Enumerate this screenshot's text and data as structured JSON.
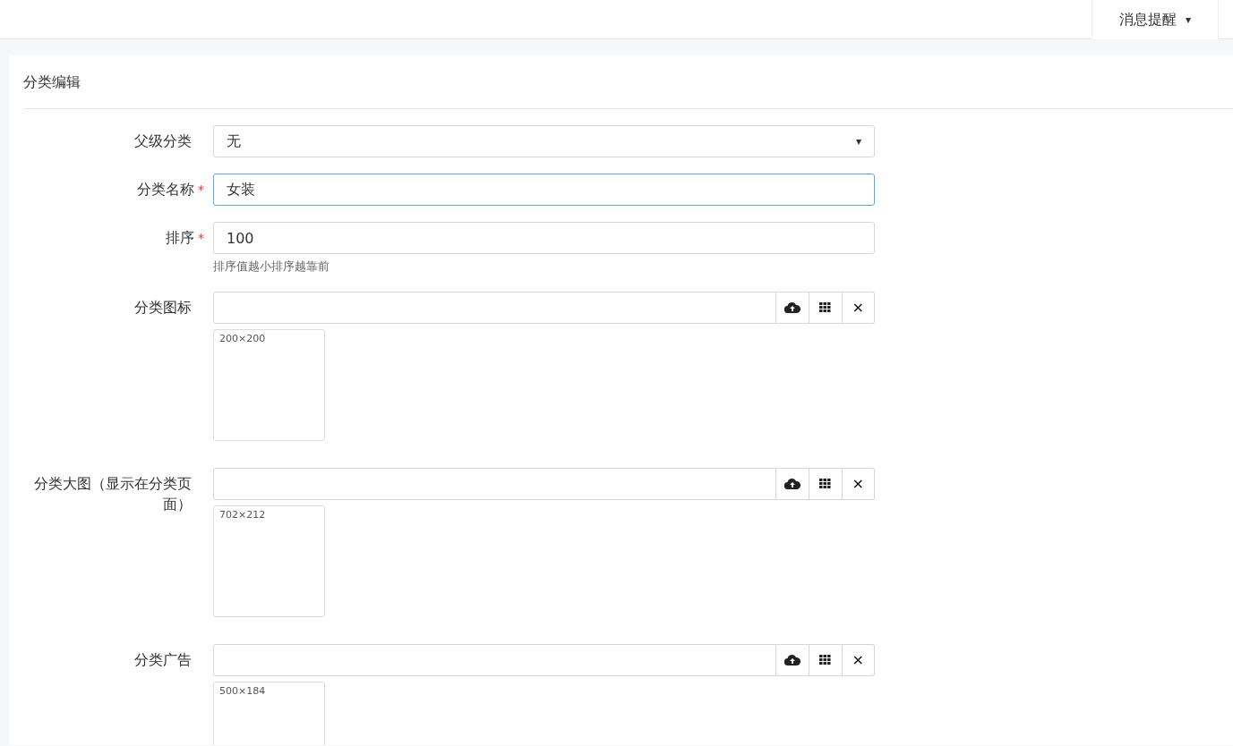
{
  "topbar": {
    "menu": {
      "label": "消息提醒",
      "caret": "▾"
    }
  },
  "panel": {
    "title": "分类编辑"
  },
  "fields": [
    {
      "kind": "select",
      "label": "父级分类",
      "required": false,
      "value": "无",
      "focused": false,
      "caret": "▾"
    },
    {
      "kind": "text",
      "label": "分类名称",
      "required": true,
      "value": "女装",
      "focused": true
    },
    {
      "kind": "text",
      "label": "排序",
      "required": true,
      "value": "100",
      "focused": false,
      "hint": "排序值越小排序越靠前"
    },
    {
      "kind": "image",
      "label": "分类图标",
      "required": false,
      "size": "200×200",
      "clear": "×"
    },
    {
      "kind": "image",
      "label": "分类大图（显示在分类页面）",
      "required": false,
      "size": "702×212",
      "clear": "×"
    },
    {
      "kind": "image",
      "label": "分类广告",
      "required": false,
      "size": "500×184",
      "clear": "×"
    }
  ],
  "required_mark": "*"
}
